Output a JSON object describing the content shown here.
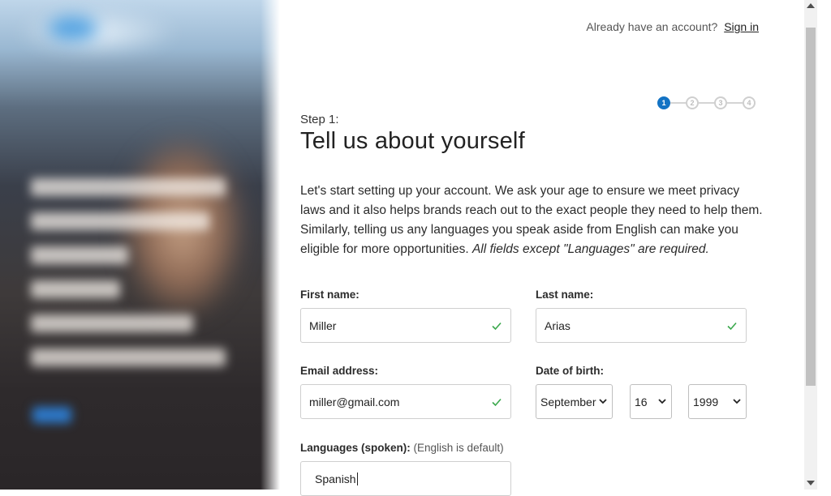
{
  "header": {
    "prompt": "Already have an account?",
    "signin_link": "Sign in"
  },
  "stepper": {
    "steps": [
      "1",
      "2",
      "3",
      "4"
    ],
    "active_step": 1
  },
  "step_label": "Step 1:",
  "title": "Tell us about yourself",
  "intro": {
    "text": "Let's start setting up your account. We ask your age to ensure we meet privacy laws and it also helps brands reach out to the exact people they need to help them. Similarly, telling us any languages you speak aside from English can make you eligible for more opportunities. ",
    "emphasis": "All fields except \"Languages\" are required."
  },
  "form": {
    "first_name": {
      "label": "First name:",
      "value": "Miller",
      "valid": true
    },
    "last_name": {
      "label": "Last name:",
      "value": "Arias",
      "valid": true
    },
    "email": {
      "label": "Email address:",
      "value": "miller@gmail.com",
      "valid": true
    },
    "dob": {
      "label": "Date of birth:",
      "month": "September",
      "day": "16",
      "year": "1999"
    },
    "languages": {
      "label": "Languages (spoken):",
      "note": "(English is default)",
      "value": "Spanish"
    }
  },
  "colors": {
    "accent": "#1373c4",
    "valid_check": "#3aa84c",
    "border": "#cfcfcf"
  },
  "icons": {
    "valid": "checkmark-icon",
    "select": "chevron-down-icon",
    "scroll_up": "scroll-up-arrow-icon",
    "scroll_down": "scroll-down-arrow-icon"
  }
}
